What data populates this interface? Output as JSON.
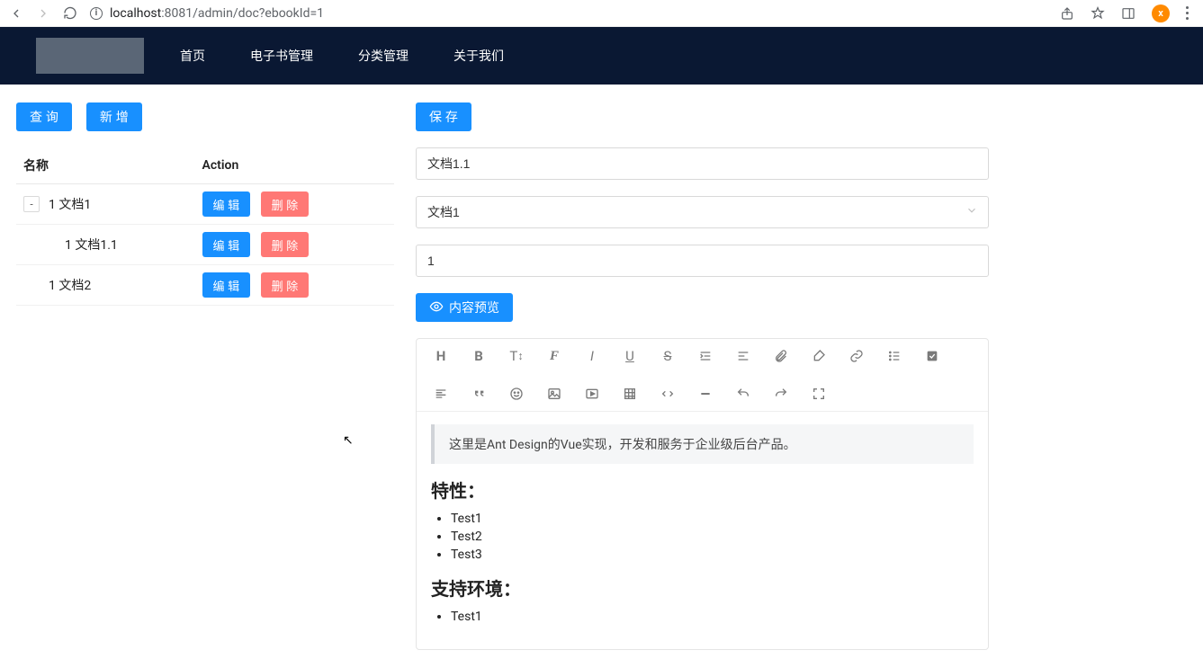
{
  "browser": {
    "url_host": "localhost",
    "url_port_path": ":8081/admin/doc?ebookId=1",
    "avatar_letter": "x"
  },
  "nav": {
    "items": [
      "首页",
      "电子书管理",
      "分类管理",
      "关于我们"
    ]
  },
  "left": {
    "query_label": "查 询",
    "add_label": "新 增",
    "col_name": "名称",
    "col_action": "Action",
    "rows": [
      {
        "name": "1 文档1",
        "expand": "-"
      },
      {
        "name": "1 文档1.1"
      },
      {
        "name": "1 文档2"
      }
    ],
    "edit_label": "编 辑",
    "delete_label": "删 除"
  },
  "right": {
    "save_label": "保 存",
    "title_value": "文档1.1",
    "parent_value": "文档1",
    "sort_value": "1",
    "preview_label": "内容预览"
  },
  "editor_content": {
    "quote": "这里是Ant Design的Vue实现，开发和服务于企业级后台产品。",
    "h_features": "特性：",
    "list": [
      "Test1",
      "Test2",
      "Test3"
    ],
    "h_env": "支持环境：",
    "cut_item": "Test1"
  },
  "toolbar_icons": [
    "heading-icon",
    "bold-icon",
    "fontsize-icon",
    "font-icon",
    "italic-icon",
    "underline-icon",
    "strike-icon",
    "indent-icon",
    "align-icon",
    "link-attach-icon",
    "brush-icon",
    "link-icon",
    "list-icon",
    "checkbox-icon",
    "align-left-icon",
    "quote-icon",
    "emoji-icon",
    "image-icon",
    "video-icon",
    "table-icon",
    "code-icon",
    "hr-icon",
    "undo-icon",
    "redo-icon",
    "fullscreen-icon"
  ]
}
